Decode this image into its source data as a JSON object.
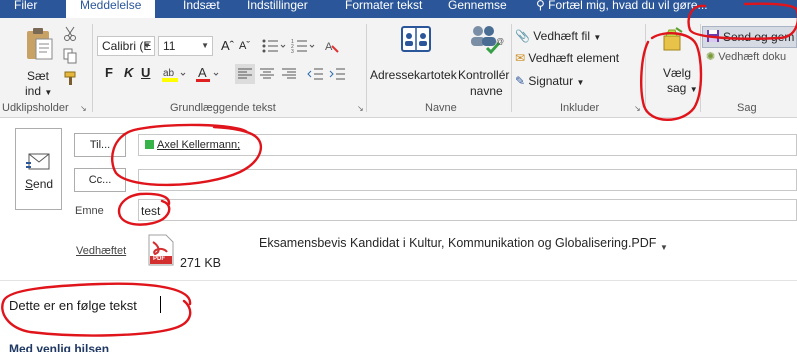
{
  "tabs": {
    "file": "Filer",
    "message": "Meddelelse",
    "insert": "Indsæt",
    "options": "Indstillinger",
    "format": "Formater tekst",
    "review": "Gennemse",
    "tellme": "Fortæl mig, hvad du vil gøre..."
  },
  "ribbon": {
    "clipboard": {
      "paste_line1": "Sæt",
      "paste_line2": "ind",
      "group_label": "Udklipsholder"
    },
    "basic_text": {
      "font_name": "Calibri (E",
      "font_size": "11",
      "bold": "F",
      "italic": "K",
      "underline": "U",
      "group_label": "Grundlæggende tekst"
    },
    "names": {
      "address_book": "Adressekartotek",
      "check_names_line1": "Kontrollér",
      "check_names_line2": "navne",
      "group_label": "Navne"
    },
    "include": {
      "attach_file": "Vedhæft fil",
      "attach_item": "Vedhæft element",
      "signature": "Signatur",
      "group_label": "Inkluder"
    },
    "choose_case": {
      "line1": "Vælg",
      "line2": "sag"
    },
    "case": {
      "send_save": "Send og gem",
      "attach_doc": "Vedhæft doku",
      "group_label": "Sag"
    }
  },
  "compose": {
    "send_label": "Send",
    "to_label": "Til...",
    "cc_label": "Cc...",
    "subject_label": "Emne",
    "attached_label": "Vedhæftet",
    "recipient": "Axel Kellermann;",
    "subject_value": "test",
    "attachment": {
      "name": "Eksamensbevis Kandidat i Kultur, Kommunikation og Globalisering.PDF",
      "size": "271 KB",
      "badge": "PDF"
    },
    "body_text": "Dette er en følge tekst",
    "signature_text": "Med venlig hilsen"
  },
  "colors": {
    "tab_bar": "#2b579a",
    "ribbon_bg": "#f3f3f3",
    "annotation": "#e0141b",
    "recipient_dot": "#37b34a",
    "pdf_red": "#d32f2f"
  }
}
